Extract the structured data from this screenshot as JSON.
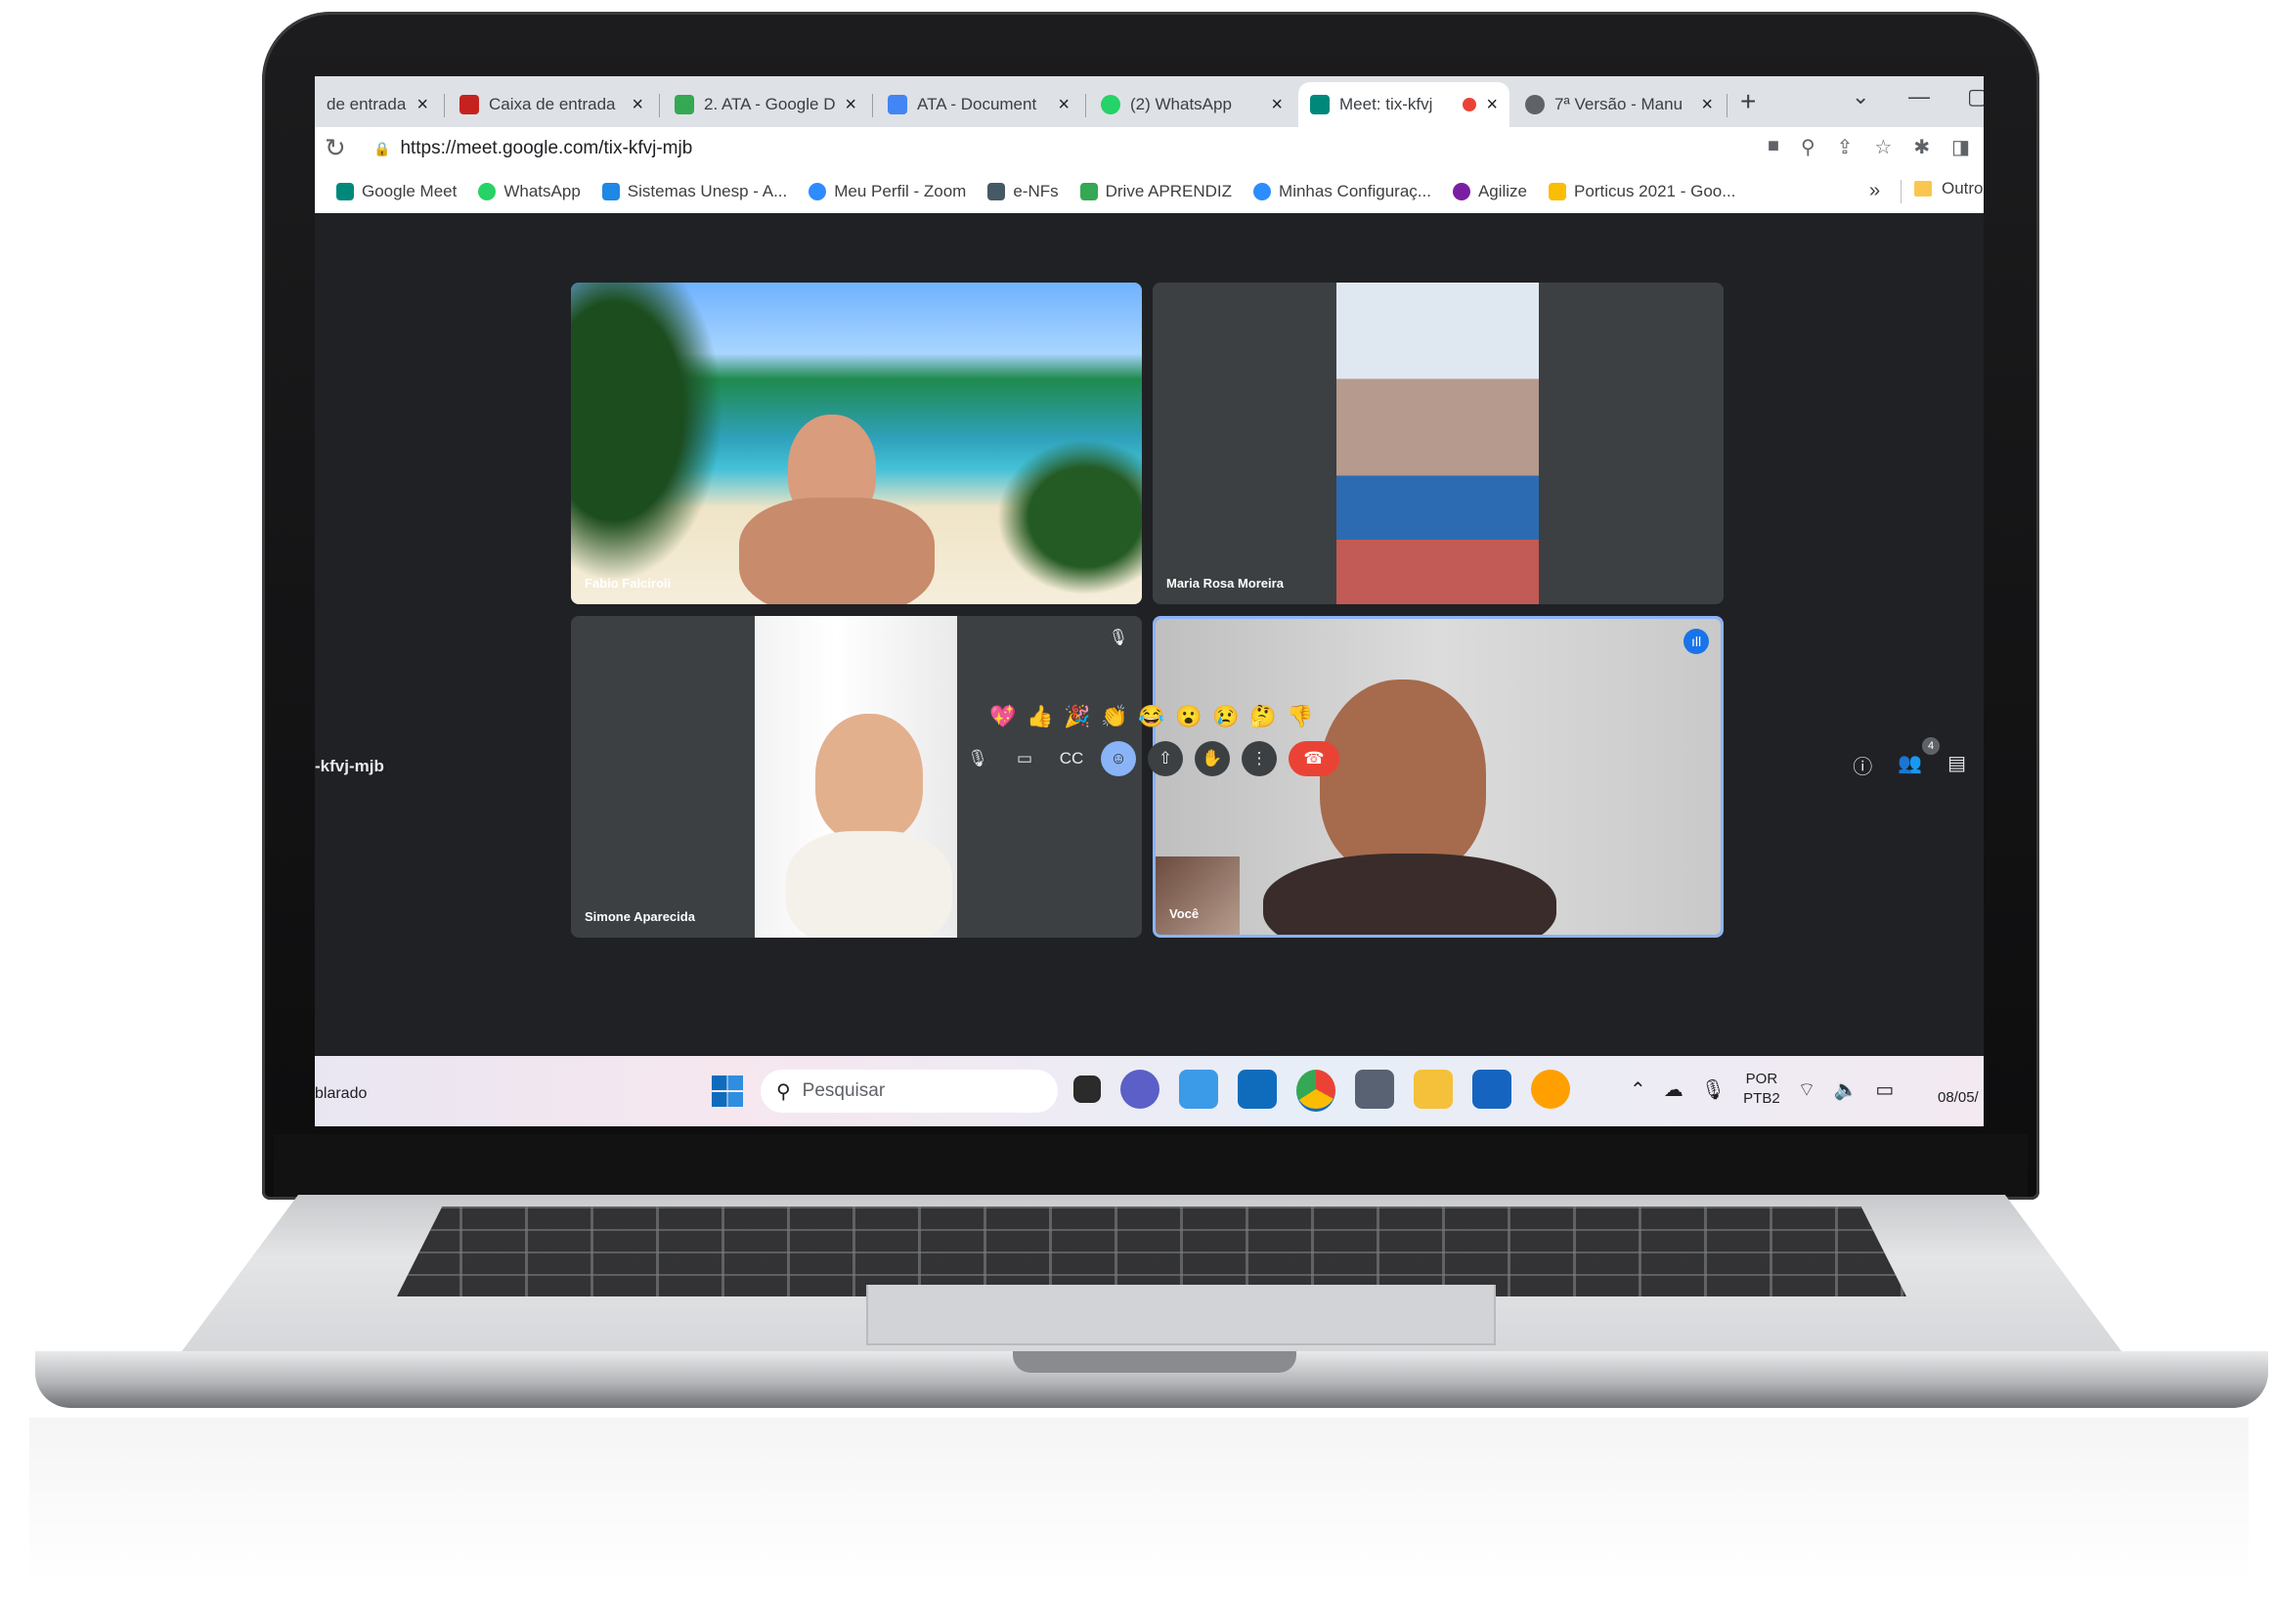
{
  "browser": {
    "tabs": [
      {
        "title": "de entrada",
        "favicon": "gmail-icon",
        "color": "#c5221f"
      },
      {
        "title": "Caixa de entrada",
        "favicon": "gmail-icon",
        "color": "#c5221f"
      },
      {
        "title": "2. ATA - Google D",
        "favicon": "google-drive-icon",
        "color": "#34a853"
      },
      {
        "title": "ATA - Document",
        "favicon": "google-docs-icon",
        "color": "#4285f4"
      },
      {
        "title": "(2) WhatsApp",
        "favicon": "whatsapp-icon",
        "color": "#25d366"
      },
      {
        "title": "Meet: tix-kfvj",
        "favicon": "google-meet-icon",
        "color": "#00897b"
      },
      {
        "title": "7ª Versão - Manu",
        "favicon": "globe-icon",
        "color": "#5f6368"
      }
    ],
    "url": "https://meet.google.com/tix-kfvj-mjb",
    "bookmarks": [
      {
        "label": "Google Meet",
        "color": "#00897b"
      },
      {
        "label": "WhatsApp",
        "color": "#25d366"
      },
      {
        "label": "Sistemas Unesp - A...",
        "color": "#1e88e5"
      },
      {
        "label": "Meu Perfil - Zoom",
        "color": "#2d8cff"
      },
      {
        "label": "e-NFs",
        "color": "#455a64"
      },
      {
        "label": "Drive APRENDIZ",
        "color": "#34a853"
      },
      {
        "label": "Minhas Configuraç...",
        "color": "#2d8cff"
      },
      {
        "label": "Agilize",
        "color": "#7b1fa2"
      },
      {
        "label": "Porticus 2021 - Goo...",
        "color": "#fbbc04"
      }
    ],
    "bookmarks_more": "»",
    "other_bookmarks": "Outro"
  },
  "meet": {
    "participants": [
      {
        "name": "Fabio Falciroli"
      },
      {
        "name": "Maria Rosa Moreira"
      },
      {
        "name": "Simone Aparecida"
      },
      {
        "name": "Você"
      }
    ],
    "reactions": [
      "💖",
      "👍",
      "🎉",
      "👏",
      "😂",
      "😮",
      "😢",
      "🤔",
      "👎"
    ],
    "meeting_code": "-kfvj-mjb",
    "participant_count": "4"
  },
  "taskbar": {
    "left_text": "blarado",
    "search_placeholder": "Pesquisar",
    "lang_top": "POR",
    "lang_bottom": "PTB2",
    "date": "08/05/"
  }
}
